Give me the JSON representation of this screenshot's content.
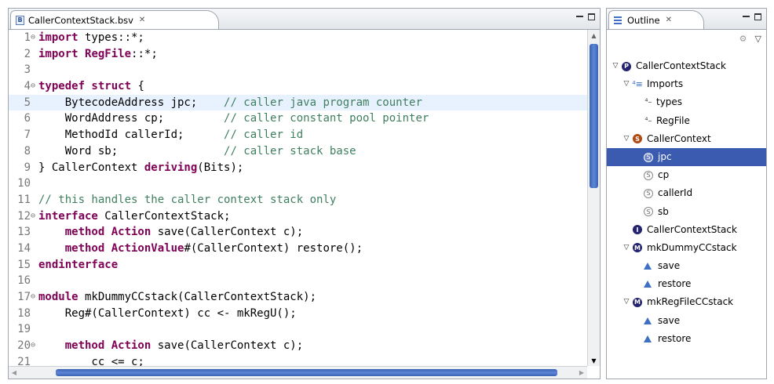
{
  "editor": {
    "tab_label": "CallerContextStack.bsv",
    "tab_close": "✕",
    "file_icon_letter": "B",
    "lines": [
      {
        "n": "1",
        "fold": "⊖",
        "tokens": [
          {
            "t": "kw",
            "v": "import"
          },
          {
            "t": "code",
            "v": " types::*;"
          }
        ]
      },
      {
        "n": "2",
        "fold": "",
        "tokens": [
          {
            "t": "kw",
            "v": "import"
          },
          {
            "t": "code",
            "v": " "
          },
          {
            "t": "kw",
            "v": "RegFile"
          },
          {
            "t": "code",
            "v": "::*;"
          }
        ]
      },
      {
        "n": "3",
        "fold": "",
        "tokens": []
      },
      {
        "n": "4",
        "fold": "⊖",
        "tokens": [
          {
            "t": "kw",
            "v": "typedef struct"
          },
          {
            "t": "code",
            "v": " {"
          }
        ]
      },
      {
        "n": "5",
        "fold": "",
        "current": true,
        "tokens": [
          {
            "t": "code",
            "v": "    BytecodeAddress jpc;    "
          },
          {
            "t": "cm",
            "v": "// caller java program counter"
          }
        ]
      },
      {
        "n": "6",
        "fold": "",
        "tokens": [
          {
            "t": "code",
            "v": "    WordAddress cp;         "
          },
          {
            "t": "cm",
            "v": "// caller constant pool pointer"
          }
        ]
      },
      {
        "n": "7",
        "fold": "",
        "tokens": [
          {
            "t": "code",
            "v": "    MethodId callerId;      "
          },
          {
            "t": "cm",
            "v": "// caller id"
          }
        ]
      },
      {
        "n": "8",
        "fold": "",
        "tokens": [
          {
            "t": "code",
            "v": "    Word sb;                "
          },
          {
            "t": "cm",
            "v": "// caller stack base"
          }
        ]
      },
      {
        "n": "9",
        "fold": "",
        "tokens": [
          {
            "t": "code",
            "v": "} CallerContext "
          },
          {
            "t": "kw",
            "v": "deriving"
          },
          {
            "t": "code",
            "v": "(Bits);"
          }
        ]
      },
      {
        "n": "10",
        "fold": "",
        "tokens": []
      },
      {
        "n": "11",
        "fold": "",
        "tokens": [
          {
            "t": "cm",
            "v": "// this handles the caller context stack only"
          }
        ]
      },
      {
        "n": "12",
        "fold": "⊖",
        "tokens": [
          {
            "t": "kw",
            "v": "interface"
          },
          {
            "t": "code",
            "v": " CallerContextStack;"
          }
        ]
      },
      {
        "n": "13",
        "fold": "",
        "tokens": [
          {
            "t": "code",
            "v": "    "
          },
          {
            "t": "kw",
            "v": "method Action"
          },
          {
            "t": "code",
            "v": " save(CallerContext c);"
          }
        ]
      },
      {
        "n": "14",
        "fold": "",
        "tokens": [
          {
            "t": "code",
            "v": "    "
          },
          {
            "t": "kw",
            "v": "method ActionValue"
          },
          {
            "t": "code",
            "v": "#(CallerContext) restore();"
          }
        ]
      },
      {
        "n": "15",
        "fold": "",
        "tokens": [
          {
            "t": "kw",
            "v": "endinterface"
          }
        ]
      },
      {
        "n": "16",
        "fold": "",
        "tokens": []
      },
      {
        "n": "17",
        "fold": "⊖",
        "tokens": [
          {
            "t": "kw",
            "v": "module"
          },
          {
            "t": "code",
            "v": " mkDummyCCstack(CallerContextStack);"
          }
        ]
      },
      {
        "n": "18",
        "fold": "",
        "tokens": [
          {
            "t": "code",
            "v": "    Reg#(CallerContext) cc <- mkRegU();"
          }
        ]
      },
      {
        "n": "19",
        "fold": "",
        "tokens": []
      },
      {
        "n": "20",
        "fold": "⊖",
        "tokens": [
          {
            "t": "code",
            "v": "    "
          },
          {
            "t": "kw",
            "v": "method Action"
          },
          {
            "t": "code",
            "v": " save(CallerContext c);"
          }
        ]
      },
      {
        "n": "21",
        "fold": "",
        "tokens": [
          {
            "t": "code",
            "v": "        cc <= c;"
          }
        ]
      }
    ]
  },
  "outline": {
    "tab_label": "Outline",
    "tab_close": "✕",
    "nodes": [
      {
        "depth": 0,
        "twisty": "▽",
        "icon": "pkg",
        "glyph": "P",
        "label": "CallerContextStack"
      },
      {
        "depth": 1,
        "twisty": "▽",
        "icon": "import",
        "glyph": "⁴≡",
        "label": "Imports"
      },
      {
        "depth": 2,
        "twisty": "",
        "icon": "importitem",
        "glyph": "⁴–",
        "label": "types"
      },
      {
        "depth": 2,
        "twisty": "",
        "icon": "importitem",
        "glyph": "⁴–",
        "label": "RegFile"
      },
      {
        "depth": 1,
        "twisty": "▽",
        "icon": "struct",
        "glyph": "S",
        "label": "CallerContext"
      },
      {
        "depth": 2,
        "twisty": "",
        "icon": "field",
        "glyph": "S",
        "label": "jpc",
        "selected": true
      },
      {
        "depth": 2,
        "twisty": "",
        "icon": "field",
        "glyph": "S",
        "label": "cp"
      },
      {
        "depth": 2,
        "twisty": "",
        "icon": "field",
        "glyph": "S",
        "label": "callerId"
      },
      {
        "depth": 2,
        "twisty": "",
        "icon": "field",
        "glyph": "S",
        "label": "sb"
      },
      {
        "depth": 1,
        "twisty": "",
        "icon": "iface",
        "glyph": "I",
        "label": "CallerContextStack"
      },
      {
        "depth": 1,
        "twisty": "▽",
        "icon": "module",
        "glyph": "M",
        "label": "mkDummyCCstack"
      },
      {
        "depth": 2,
        "twisty": "",
        "icon": "method",
        "glyph": "",
        "label": "save"
      },
      {
        "depth": 2,
        "twisty": "",
        "icon": "method",
        "glyph": "",
        "label": "restore"
      },
      {
        "depth": 1,
        "twisty": "▽",
        "icon": "module",
        "glyph": "M",
        "label": "mkRegFileCCstack"
      },
      {
        "depth": 2,
        "twisty": "",
        "icon": "method",
        "glyph": "",
        "label": "save"
      },
      {
        "depth": 2,
        "twisty": "",
        "icon": "method",
        "glyph": "",
        "label": "restore"
      }
    ]
  },
  "colors": {
    "keyword": "#7f0055",
    "comment": "#3f7f5f",
    "selection": "#3b5bb0",
    "current_line": "#e8f2fe"
  }
}
